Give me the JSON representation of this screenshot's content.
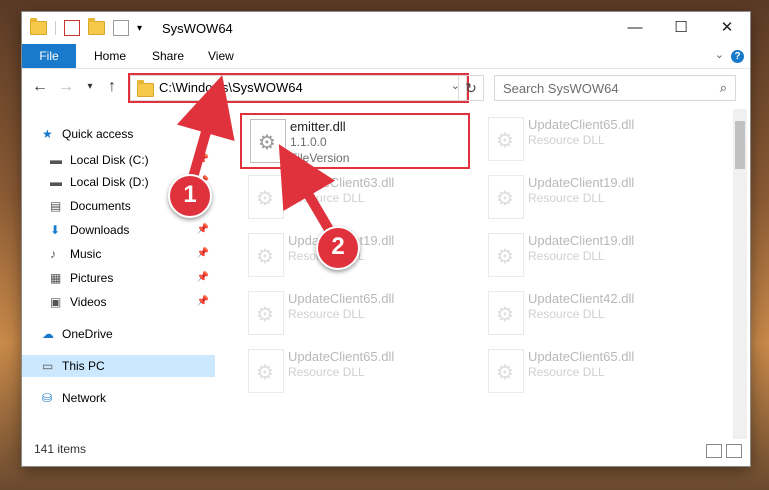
{
  "window": {
    "title": "SysWOW64",
    "controls": [
      "minimize",
      "maximize",
      "close"
    ]
  },
  "ribbon": {
    "tabs": [
      "File",
      "Home",
      "Share",
      "View"
    ]
  },
  "address": {
    "path": "C:\\Windows\\SysWOW64",
    "search_placeholder": "Search SysWOW64"
  },
  "nav": {
    "items": [
      {
        "label": "Quick access",
        "icon": "star-icon",
        "pinned": false
      },
      {
        "label": "Local Disk (C:)",
        "icon": "drive-icon",
        "pinned": true
      },
      {
        "label": "Local Disk (D:)",
        "icon": "drive-icon",
        "pinned": true
      },
      {
        "label": "Documents",
        "icon": "documents-icon",
        "pinned": true
      },
      {
        "label": "Downloads",
        "icon": "download-icon",
        "pinned": true
      },
      {
        "label": "Music",
        "icon": "music-icon",
        "pinned": true
      },
      {
        "label": "Pictures",
        "icon": "pictures-icon",
        "pinned": true
      },
      {
        "label": "Videos",
        "icon": "videos-icon",
        "pinned": true
      },
      {
        "label": "OneDrive",
        "icon": "cloud-icon",
        "pinned": false
      },
      {
        "label": "This PC",
        "icon": "computer-icon",
        "pinned": false,
        "selected": true
      },
      {
        "label": "Network",
        "icon": "network-icon",
        "pinned": false
      }
    ]
  },
  "files": {
    "highlighted": {
      "name": "emitter.dll",
      "version": "1.1.0.0",
      "desc": "FileVersion"
    },
    "faded": [
      {
        "name": "UpdateClient65.dll",
        "desc": "Resource DLL"
      },
      {
        "name": "UpdateClient63.dll",
        "desc": "Resource DLL"
      },
      {
        "name": "UpdateClient19.dll",
        "desc": "Resource DLL"
      },
      {
        "name": "UpdateClient19.dll",
        "desc": "Resource DLL"
      },
      {
        "name": "UpdateClient19.dll",
        "desc": "Resource DLL"
      },
      {
        "name": "UpdateClient65.dll",
        "desc": "Resource DLL"
      },
      {
        "name": "UpdateClient42.dll",
        "desc": "Resource DLL"
      },
      {
        "name": "UpdateClient65.dll",
        "desc": "Resource DLL"
      },
      {
        "name": "UpdateClient65.dll",
        "desc": "Resource DLL"
      }
    ]
  },
  "status": {
    "count": "141 items"
  },
  "annotations": {
    "badge1": "1",
    "badge2": "2",
    "color": "#e0323c"
  }
}
